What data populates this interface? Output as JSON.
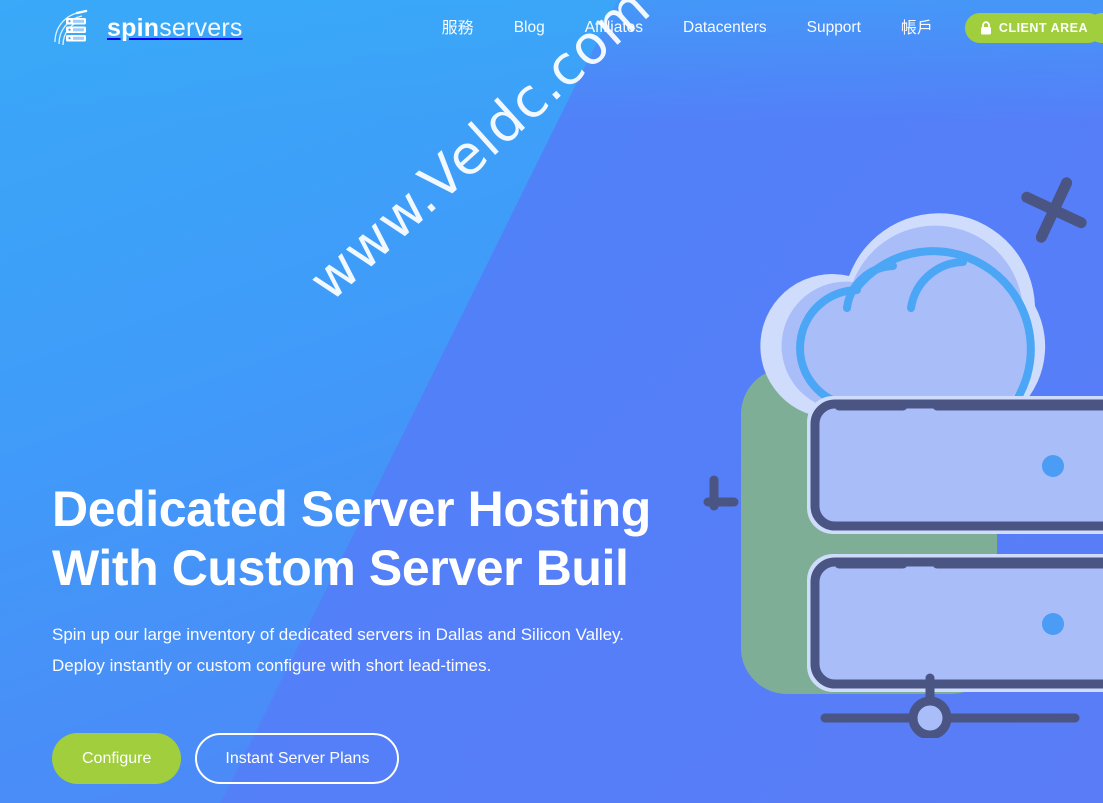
{
  "brand": {
    "name_bold": "spin",
    "name_light": "servers",
    "logo_icon": "server-rack-swoosh-icon"
  },
  "nav": {
    "items": [
      {
        "label": "服務",
        "cjk": true
      },
      {
        "label": "Blog",
        "cjk": false
      },
      {
        "label": "Affiliates",
        "cjk": false
      },
      {
        "label": "Datacenters",
        "cjk": false
      },
      {
        "label": "Support",
        "cjk": false
      },
      {
        "label": "帳戶",
        "cjk": true
      }
    ],
    "client_area_label": "CLIENT AREA",
    "client_area_icon": "lock-icon"
  },
  "hero": {
    "heading": "Dedicated Server Hosting\nWith Custom Server Buil",
    "subtext": "Spin up our large inventory of dedicated servers in Dallas and Silicon Valley.\nDeploy instantly or custom configure with short lead-times.",
    "primary_cta": "Configure",
    "secondary_cta": "Instant Server Plans"
  },
  "watermark": {
    "text": "www.Veldc.com"
  },
  "illustration": {
    "name": "cloud-server-rack-illustration",
    "parts": [
      "cloud-icon",
      "server-rack-icon",
      "server-rack-icon",
      "slider-icon",
      "ring-icon",
      "cross-icon"
    ]
  },
  "colors": {
    "accent_green": "#a0ce3c",
    "bg_blue_left": "#39a8f7",
    "bg_blue_right": "#5a7cf7",
    "illus_navy": "#4a5583",
    "illus_light": "#a9bdf9",
    "illus_cyan": "#4ba6f5",
    "illus_green": "#7fae97",
    "text_white": "#ffffff"
  }
}
